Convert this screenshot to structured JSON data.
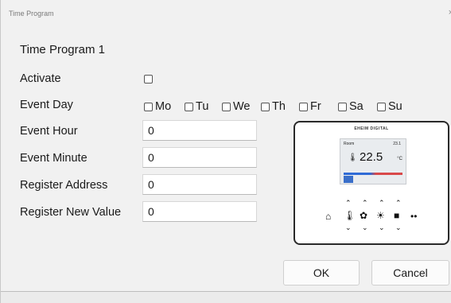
{
  "window": {
    "title": "Time Program",
    "close_glyph": "×"
  },
  "heading": "Time Program 1",
  "fields": {
    "activate_label": "Activate",
    "event_day_label": "Event Day",
    "event_hour_label": "Event Hour",
    "event_hour_value": "0",
    "event_minute_label": "Event Minute",
    "event_minute_value": "0",
    "register_address_label": "Register Address",
    "register_address_value": "0",
    "register_new_value_label": "Register New Value",
    "register_new_value_value": "0"
  },
  "days": [
    "Mo",
    "Tu",
    "We",
    "Th",
    "Fr",
    "Sa",
    "Su"
  ],
  "device": {
    "brand_text": "EHEIM DIGITAL",
    "screen_top_left": "Room",
    "screen_top_right": "23.1",
    "temperature": "22.5",
    "unit": "°C",
    "icons": [
      "home-icon",
      "thermometer-icon",
      "fan-icon",
      "sun-icon",
      "square-icon",
      "radio-wave-icon"
    ]
  },
  "buttons": {
    "ok_label": "OK",
    "cancel_label": "Cancel"
  }
}
